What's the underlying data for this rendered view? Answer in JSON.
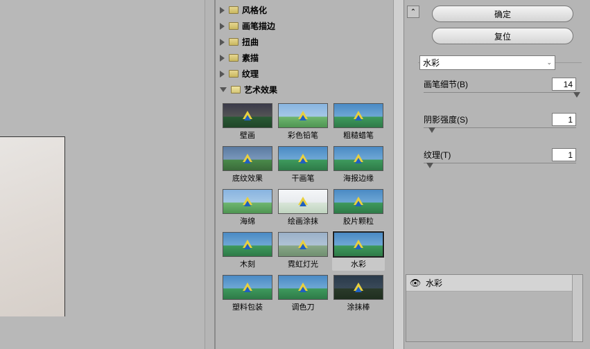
{
  "categories": {
    "stylize": "风格化",
    "brushstrokes": "画笔描边",
    "distort": "扭曲",
    "sketch": "素描",
    "texture": "纹理",
    "artistic": "艺术效果"
  },
  "thumbs": {
    "t1": "壁画",
    "t2": "彩色铅笔",
    "t3": "粗糙蜡笔",
    "t4": "底纹效果",
    "t5": "干画笔",
    "t6": "海报边缘",
    "t7": "海绵",
    "t8": "绘画涂抹",
    "t9": "胶片颗粒",
    "t10": "木刻",
    "t11": "霓虹灯光",
    "t12": "水彩",
    "t13": "塑料包装",
    "t14": "调色刀",
    "t15": "涂抹棒"
  },
  "buttons": {
    "ok": "确定",
    "reset": "复位"
  },
  "select": {
    "value": "水彩"
  },
  "params": {
    "brush_detail_label": "画笔细节(B)",
    "brush_detail_value": "14",
    "shadow_label": "阴影强度(S)",
    "shadow_value": "1",
    "texture_label": "纹理(T)",
    "texture_value": "1"
  },
  "effects": {
    "current": "水彩"
  },
  "chart_data": null
}
